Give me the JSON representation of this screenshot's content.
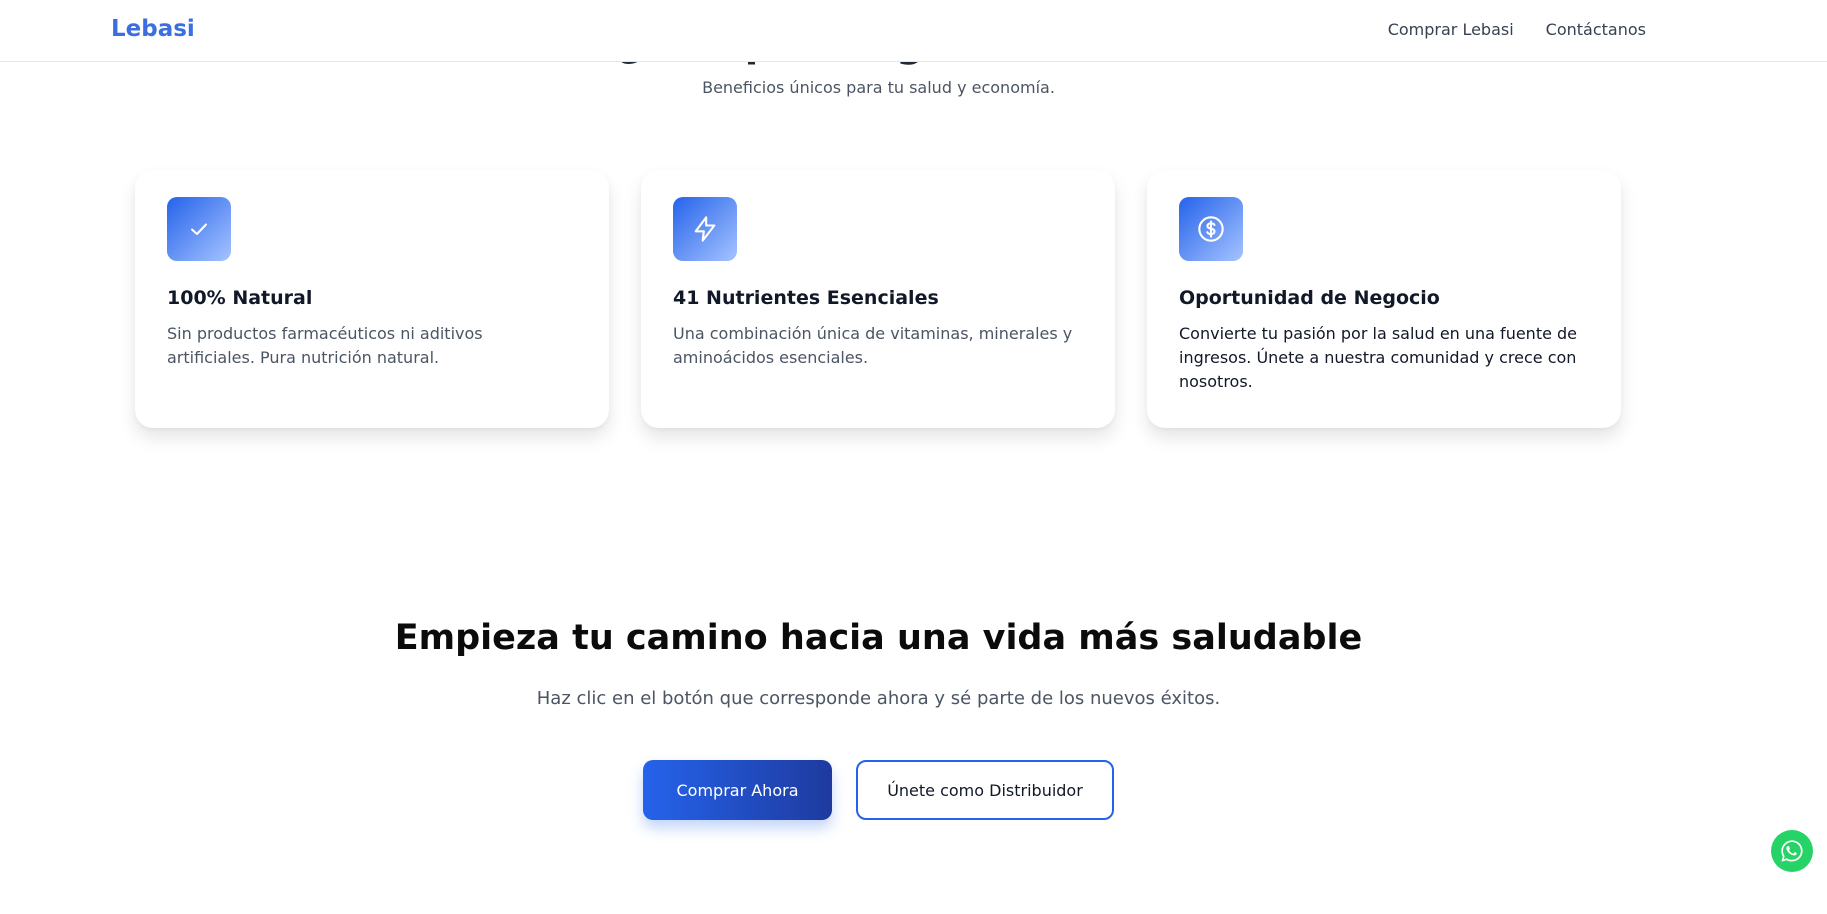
{
  "navbar": {
    "brand": "Lebasi",
    "links": [
      {
        "label": "Comprar Lebasi"
      },
      {
        "label": "Contáctanos"
      }
    ]
  },
  "section": {
    "title": "¿Por qué elegir Lebasi?",
    "subtitle": "Beneficios únicos para tu salud y economía."
  },
  "features": [
    {
      "icon": "check-icon",
      "title": "100% Natural",
      "text": "Sin productos farmacéuticos ni aditivos artificiales. Pura nutrición natural."
    },
    {
      "icon": "lightning-icon",
      "title": "41 Nutrientes Esenciales",
      "text": "Una combinación única de vitaminas, minerales y aminoácidos esenciales."
    },
    {
      "icon": "dollar-icon",
      "title": "Oportunidad de Negocio",
      "text": "Convierte tu pasión por la salud en una fuente de ingresos. Únete a nuestra comunidad y crece con nosotros."
    }
  ],
  "cta": {
    "title": "Empieza tu camino hacia una vida más saludable",
    "subtitle": "Haz clic en el botón que corresponde ahora y sé parte de los nuevos éxitos.",
    "primary_label": "Comprar Ahora",
    "secondary_label": "Únete como Distribuidor"
  },
  "floating": {
    "icon": "whatsapp-icon"
  },
  "colors": {
    "brand": "#3b6fe0",
    "accent": "#2563eb",
    "whatsapp": "#25d366"
  }
}
